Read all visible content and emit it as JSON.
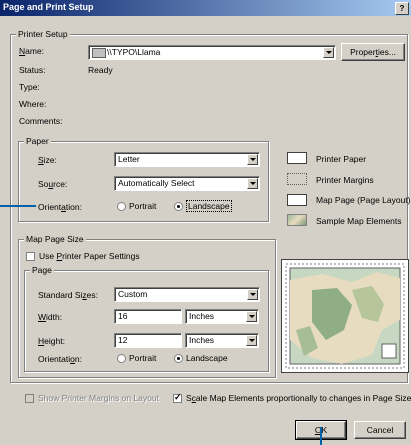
{
  "window": {
    "title": "Page and Print Setup",
    "help": "?"
  },
  "printer_setup": {
    "group_title": "Printer Setup",
    "name_label": "Name:",
    "name_value": "\\\\TYPO\\Llama",
    "properties_button": "Properties...",
    "status_label": "Status:",
    "status_value": "Ready",
    "type_label": "Type:",
    "where_label": "Where:",
    "comments_label": "Comments:"
  },
  "paper": {
    "group_title": "Paper",
    "size_label": "Size:",
    "size_value": "Letter",
    "source_label": "Source:",
    "source_value": "Automatically Select",
    "orientation_label": "Orientation:",
    "portrait": "Portrait",
    "landscape": "Landscape",
    "selected": "landscape"
  },
  "legend": {
    "printer_paper": "Printer Paper",
    "printer_margins": "Printer Margins",
    "map_page": "Map Page (Page Layout)",
    "sample_elements": "Sample Map Elements"
  },
  "map_page_size": {
    "group_title": "Map Page Size",
    "use_printer_paper": "Use Printer Paper Settings",
    "use_printer_paper_checked": false,
    "page_group_title": "Page",
    "standard_sizes_label": "Standard Sizes:",
    "standard_sizes_value": "Custom",
    "width_label": "Width:",
    "width_value": "16",
    "width_unit": "Inches",
    "height_label": "Height:",
    "height_value": "12",
    "height_unit": "Inches",
    "orientation_label": "Orientation:",
    "portrait": "Portrait",
    "landscape": "Landscape",
    "selected": "landscape"
  },
  "bottom": {
    "show_margins": "Show Printer Margins on Layout",
    "scale_elements": "Scale Map Elements proportionally to changes in Page Size",
    "scale_checked": true,
    "ok": "OK",
    "cancel": "Cancel"
  },
  "colors": {
    "titlebar": "#0a246a",
    "dialog": "#d4d0c8",
    "annotation": "#0062a8"
  }
}
